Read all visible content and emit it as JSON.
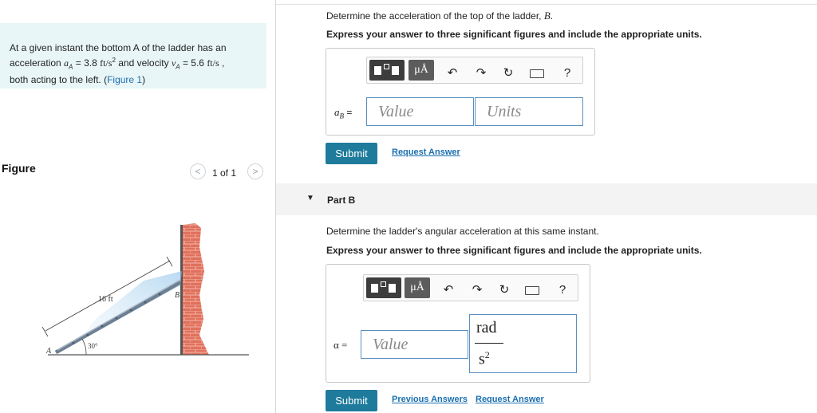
{
  "problem": {
    "line1": "At a given instant the bottom A of the ladder has an",
    "line2_pre": "acceleration ",
    "aA_sym": "a",
    "aA_sub": "A",
    "aA_eq": " = 3.8 ",
    "aA_unit": "ft/s",
    "aA_exp": "2",
    "line2_mid": " and velocity ",
    "vA_sym": "v",
    "vA_sub": "A",
    "vA_eq": " = 5.6 ",
    "vA_unit": "ft/s",
    "line2_end": " ,",
    "line3": "both acting to the left. (",
    "figure_link": "Figure 1",
    "line3_end": ")"
  },
  "figure": {
    "title": "Figure",
    "pager": "1 of 1",
    "prev": "<",
    "next": ">",
    "label_length": "16 ft",
    "label_angle": "30°",
    "label_A": "A",
    "label_B": "B"
  },
  "partA": {
    "question_pre": "Determine the acceleration of the top of the ladder, ",
    "question_var": "B",
    "question_post": ".",
    "instruction": "Express your answer to three significant figures and include the appropriate units.",
    "var_label": "a",
    "var_sub": "B",
    "var_eq": " =",
    "value_placeholder": "Value",
    "units_placeholder": "Units",
    "submit": "Submit",
    "request": "Request Answer"
  },
  "partB": {
    "label": "Part B",
    "question": "Determine the ladder's angular acceleration at this same instant.",
    "instruction": "Express your answer to three significant figures and include the appropriate units.",
    "var_label": "α =",
    "value_placeholder": "Value",
    "unit_num": "rad",
    "unit_den": "s",
    "unit_exp": "2",
    "submit": "Submit",
    "previous": "Previous Answers",
    "request": "Request Answer"
  },
  "toolbar": {
    "mu_label": "μÅ",
    "help": "?"
  },
  "colors": {
    "accent": "#1e7b9c",
    "link": "#1a6fb0",
    "problem_bg": "#e9f6f8",
    "brick": "#d9543f"
  }
}
